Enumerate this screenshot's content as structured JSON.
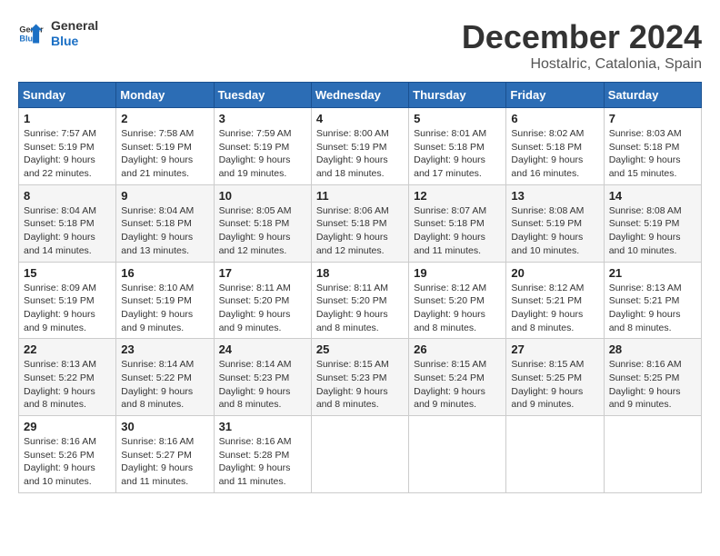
{
  "header": {
    "logo_line1": "General",
    "logo_line2": "Blue",
    "month_year": "December 2024",
    "location": "Hostalric, Catalonia, Spain"
  },
  "weekdays": [
    "Sunday",
    "Monday",
    "Tuesday",
    "Wednesday",
    "Thursday",
    "Friday",
    "Saturday"
  ],
  "weeks": [
    [
      {
        "day": "1",
        "sunrise": "7:57 AM",
        "sunset": "5:19 PM",
        "daylight": "9 hours and 22 minutes."
      },
      {
        "day": "2",
        "sunrise": "7:58 AM",
        "sunset": "5:19 PM",
        "daylight": "9 hours and 21 minutes."
      },
      {
        "day": "3",
        "sunrise": "7:59 AM",
        "sunset": "5:19 PM",
        "daylight": "9 hours and 19 minutes."
      },
      {
        "day": "4",
        "sunrise": "8:00 AM",
        "sunset": "5:19 PM",
        "daylight": "9 hours and 18 minutes."
      },
      {
        "day": "5",
        "sunrise": "8:01 AM",
        "sunset": "5:18 PM",
        "daylight": "9 hours and 17 minutes."
      },
      {
        "day": "6",
        "sunrise": "8:02 AM",
        "sunset": "5:18 PM",
        "daylight": "9 hours and 16 minutes."
      },
      {
        "day": "7",
        "sunrise": "8:03 AM",
        "sunset": "5:18 PM",
        "daylight": "9 hours and 15 minutes."
      }
    ],
    [
      {
        "day": "8",
        "sunrise": "8:04 AM",
        "sunset": "5:18 PM",
        "daylight": "9 hours and 14 minutes."
      },
      {
        "day": "9",
        "sunrise": "8:04 AM",
        "sunset": "5:18 PM",
        "daylight": "9 hours and 13 minutes."
      },
      {
        "day": "10",
        "sunrise": "8:05 AM",
        "sunset": "5:18 PM",
        "daylight": "9 hours and 12 minutes."
      },
      {
        "day": "11",
        "sunrise": "8:06 AM",
        "sunset": "5:18 PM",
        "daylight": "9 hours and 12 minutes."
      },
      {
        "day": "12",
        "sunrise": "8:07 AM",
        "sunset": "5:18 PM",
        "daylight": "9 hours and 11 minutes."
      },
      {
        "day": "13",
        "sunrise": "8:08 AM",
        "sunset": "5:19 PM",
        "daylight": "9 hours and 10 minutes."
      },
      {
        "day": "14",
        "sunrise": "8:08 AM",
        "sunset": "5:19 PM",
        "daylight": "9 hours and 10 minutes."
      }
    ],
    [
      {
        "day": "15",
        "sunrise": "8:09 AM",
        "sunset": "5:19 PM",
        "daylight": "9 hours and 9 minutes."
      },
      {
        "day": "16",
        "sunrise": "8:10 AM",
        "sunset": "5:19 PM",
        "daylight": "9 hours and 9 minutes."
      },
      {
        "day": "17",
        "sunrise": "8:11 AM",
        "sunset": "5:20 PM",
        "daylight": "9 hours and 9 minutes."
      },
      {
        "day": "18",
        "sunrise": "8:11 AM",
        "sunset": "5:20 PM",
        "daylight": "9 hours and 8 minutes."
      },
      {
        "day": "19",
        "sunrise": "8:12 AM",
        "sunset": "5:20 PM",
        "daylight": "9 hours and 8 minutes."
      },
      {
        "day": "20",
        "sunrise": "8:12 AM",
        "sunset": "5:21 PM",
        "daylight": "9 hours and 8 minutes."
      },
      {
        "day": "21",
        "sunrise": "8:13 AM",
        "sunset": "5:21 PM",
        "daylight": "9 hours and 8 minutes."
      }
    ],
    [
      {
        "day": "22",
        "sunrise": "8:13 AM",
        "sunset": "5:22 PM",
        "daylight": "9 hours and 8 minutes."
      },
      {
        "day": "23",
        "sunrise": "8:14 AM",
        "sunset": "5:22 PM",
        "daylight": "9 hours and 8 minutes."
      },
      {
        "day": "24",
        "sunrise": "8:14 AM",
        "sunset": "5:23 PM",
        "daylight": "9 hours and 8 minutes."
      },
      {
        "day": "25",
        "sunrise": "8:15 AM",
        "sunset": "5:23 PM",
        "daylight": "9 hours and 8 minutes."
      },
      {
        "day": "26",
        "sunrise": "8:15 AM",
        "sunset": "5:24 PM",
        "daylight": "9 hours and 9 minutes."
      },
      {
        "day": "27",
        "sunrise": "8:15 AM",
        "sunset": "5:25 PM",
        "daylight": "9 hours and 9 minutes."
      },
      {
        "day": "28",
        "sunrise": "8:16 AM",
        "sunset": "5:25 PM",
        "daylight": "9 hours and 9 minutes."
      }
    ],
    [
      {
        "day": "29",
        "sunrise": "8:16 AM",
        "sunset": "5:26 PM",
        "daylight": "9 hours and 10 minutes."
      },
      {
        "day": "30",
        "sunrise": "8:16 AM",
        "sunset": "5:27 PM",
        "daylight": "9 hours and 11 minutes."
      },
      {
        "day": "31",
        "sunrise": "8:16 AM",
        "sunset": "5:28 PM",
        "daylight": "9 hours and 11 minutes."
      },
      null,
      null,
      null,
      null
    ]
  ],
  "labels": {
    "sunrise": "Sunrise:",
    "sunset": "Sunset:",
    "daylight": "Daylight:"
  }
}
